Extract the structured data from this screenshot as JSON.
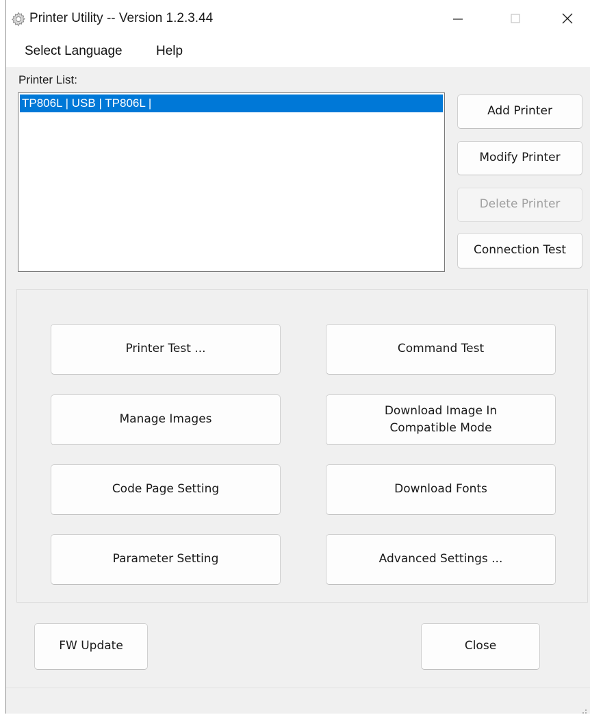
{
  "window": {
    "title": "Printer Utility -- Version 1.2.3.44",
    "icon": "gear-icon",
    "controls": {
      "minimize": "minimize-icon",
      "maximize": "maximize-icon",
      "close": "close-icon"
    }
  },
  "menubar": {
    "items": [
      {
        "label": "Select Language"
      },
      {
        "label": "Help"
      }
    ]
  },
  "printer_list": {
    "label": "Printer List:",
    "items": [
      {
        "text": "TP806L | USB | TP806L |",
        "selected": true
      }
    ]
  },
  "side_buttons": {
    "add": "Add Printer",
    "modify": "Modify Printer",
    "delete": "Delete Printer",
    "connection_test": "Connection Test"
  },
  "function_buttons": {
    "printer_test": "Printer Test ...",
    "command_test": "Command Test",
    "manage_images": "Manage Images",
    "download_image_compat_line1": "Download Image In",
    "download_image_compat_line2": "Compatible Mode",
    "code_page": "Code Page Setting",
    "download_fonts": "Download Fonts",
    "parameter_setting": "Parameter Setting",
    "advanced_settings": "Advanced Settings ..."
  },
  "bottom_buttons": {
    "fw_update": "FW Update",
    "close": "Close"
  },
  "colors": {
    "selection": "#0078d7",
    "window_bg": "#f0f0f0",
    "disabled_text": "#a0a0a0"
  }
}
